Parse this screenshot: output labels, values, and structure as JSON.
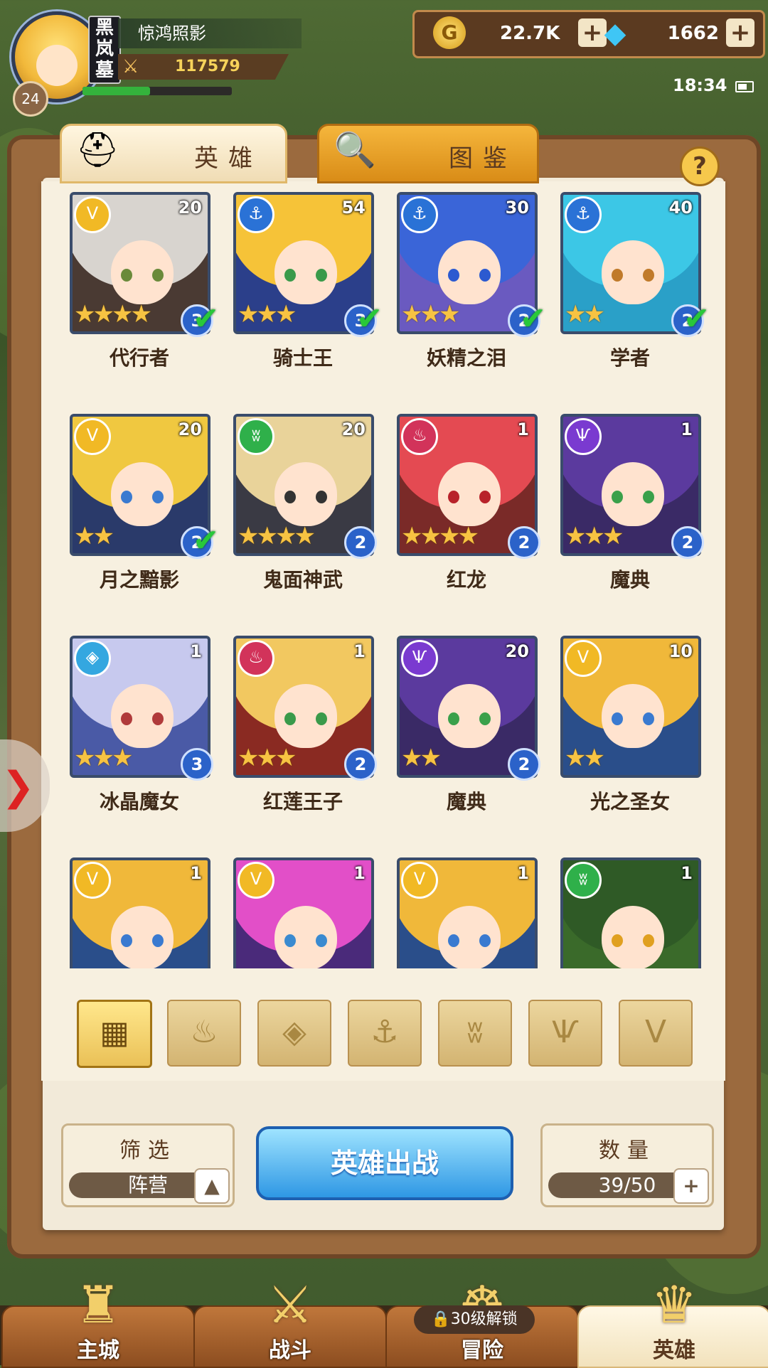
{
  "player": {
    "name": "惊鸿照影",
    "level": "24",
    "vip_label": "黑岚墓",
    "power": "117579",
    "hp_fraction": 0.45
  },
  "currency": {
    "gold": "22.7K",
    "gems": "1662"
  },
  "status": {
    "time": "18:34"
  },
  "tabs": {
    "heroes": "英雄",
    "codex": "图鉴"
  },
  "help_label": "?",
  "faction_icons": {
    "crown": "Ⅴ",
    "anchor": "⚓",
    "beast": "ʬ",
    "flame": "♨",
    "demon": "Ѱ",
    "crystal": "◈"
  },
  "heroes": [
    {
      "name": "代行者",
      "level": "20",
      "stars": "★★★★",
      "rank": "3",
      "checked": true,
      "faction": "crown",
      "hair": "#d8d4cf",
      "bg": "#4a3a33",
      "eye": "#6a8a3a"
    },
    {
      "name": "骑士王",
      "level": "54",
      "stars": "★★★",
      "rank": "3",
      "checked": true,
      "faction": "anchor",
      "hair": "#f6c338",
      "bg": "#2b3f8a",
      "eye": "#3a9a4a"
    },
    {
      "name": "妖精之泪",
      "level": "30",
      "stars": "★★★",
      "rank": "2",
      "checked": true,
      "faction": "anchor",
      "hair": "#3a65d8",
      "bg": "#6a5ac0",
      "eye": "#2c5ad0"
    },
    {
      "name": "学者",
      "level": "40",
      "stars": "★★",
      "rank": "2",
      "checked": true,
      "faction": "anchor",
      "hair": "#3cc7e6",
      "bg": "#2aa0c8",
      "eye": "#c07a2a"
    },
    {
      "name": "月之黯影",
      "level": "20",
      "stars": "★★",
      "rank": "2",
      "checked": true,
      "faction": "crown",
      "hair": "#f0c840",
      "bg": "#2a3a6a",
      "eye": "#3a7ad0"
    },
    {
      "name": "鬼面神武",
      "level": "20",
      "stars": "★★★★",
      "rank": "2",
      "checked": false,
      "faction": "beast",
      "hair": "#e9d39a",
      "bg": "#3a3a44",
      "eye": "#333333"
    },
    {
      "name": "红龙",
      "level": "1",
      "stars": "★★★★",
      "rank": "2",
      "checked": false,
      "faction": "flame",
      "hair": "#e44a52",
      "bg": "#7a2a28",
      "eye": "#b8222a"
    },
    {
      "name": "魔典",
      "level": "1",
      "stars": "★★★",
      "rank": "2",
      "checked": false,
      "faction": "demon",
      "hair": "#5b3a9e",
      "bg": "#3a2a66",
      "eye": "#3aa04a"
    },
    {
      "name": "冰晶魔女",
      "level": "1",
      "stars": "★★★",
      "rank": "3",
      "checked": false,
      "faction": "crystal",
      "hair": "#c7c9ee",
      "bg": "#4a5aa6",
      "eye": "#b03a3a"
    },
    {
      "name": "红莲王子",
      "level": "1",
      "stars": "★★★",
      "rank": "2",
      "checked": false,
      "faction": "flame",
      "hair": "#f2c860",
      "bg": "#8a2a22",
      "eye": "#3a9a4a"
    },
    {
      "name": "魔典",
      "level": "20",
      "stars": "★★",
      "rank": "2",
      "checked": false,
      "faction": "demon",
      "hair": "#5b3a9e",
      "bg": "#3a2a66",
      "eye": "#3aa04a"
    },
    {
      "name": "光之圣女",
      "level": "10",
      "stars": "★★",
      "rank": "",
      "checked": false,
      "faction": "crown",
      "hair": "#f0b83a",
      "bg": "#2a4e8a",
      "eye": "#3a7ad0"
    },
    {
      "name": "",
      "level": "1",
      "stars": "",
      "rank": "",
      "checked": false,
      "faction": "crown",
      "hair": "#f0b83a",
      "bg": "#2a4e8a",
      "eye": "#3a7ad0"
    },
    {
      "name": "",
      "level": "1",
      "stars": "",
      "rank": "",
      "checked": false,
      "faction": "crown",
      "hair": "#e24fc8",
      "bg": "#4a2a7a",
      "eye": "#3a8ad0"
    },
    {
      "name": "",
      "level": "1",
      "stars": "",
      "rank": "",
      "checked": false,
      "faction": "crown",
      "hair": "#f0b83a",
      "bg": "#2a4e8a",
      "eye": "#3a7ad0"
    },
    {
      "name": "",
      "level": "1",
      "stars": "",
      "rank": "",
      "checked": false,
      "faction": "beast",
      "hair": "#2f5a26",
      "bg": "#3a6a2a",
      "eye": "#e0a020"
    }
  ],
  "faction_colors": {
    "crown": "#f1b925",
    "anchor": "#2a72d6",
    "beast": "#2fb04a",
    "flame": "#d2335a",
    "demon": "#7a3ad0",
    "crystal": "#34a7e0"
  },
  "filters": [
    {
      "icon": "grid-icon",
      "glyph": "▦",
      "active": true
    },
    {
      "icon": "flame-icon",
      "glyph": "♨",
      "active": false
    },
    {
      "icon": "crystal-icon",
      "glyph": "◈",
      "active": false
    },
    {
      "icon": "anchor-icon",
      "glyph": "⚓",
      "active": false
    },
    {
      "icon": "beast-icon",
      "glyph": "ʬ",
      "active": false
    },
    {
      "icon": "demon-icon",
      "glyph": "Ѱ",
      "active": false
    },
    {
      "icon": "crown-icon",
      "glyph": "Ⅴ",
      "active": false
    }
  ],
  "filter_panel": {
    "title": "筛选",
    "value": "阵营",
    "button": "▲"
  },
  "deploy_label": "英雄出战",
  "count_panel": {
    "title": "数量",
    "value": "39/50",
    "button": "+"
  },
  "nav": [
    {
      "label": "主城",
      "icon": "castle-icon",
      "glyph": "♜",
      "active": false
    },
    {
      "label": "战斗",
      "icon": "crossed-swords-icon",
      "glyph": "⚔",
      "active": false
    },
    {
      "label": "冒险",
      "icon": "map-icon",
      "glyph": "☸",
      "active": false
    },
    {
      "label": "英雄",
      "icon": "hero-helmet-icon",
      "glyph": "♛",
      "active": true
    }
  ],
  "lock_tag": "🔒30级解锁"
}
